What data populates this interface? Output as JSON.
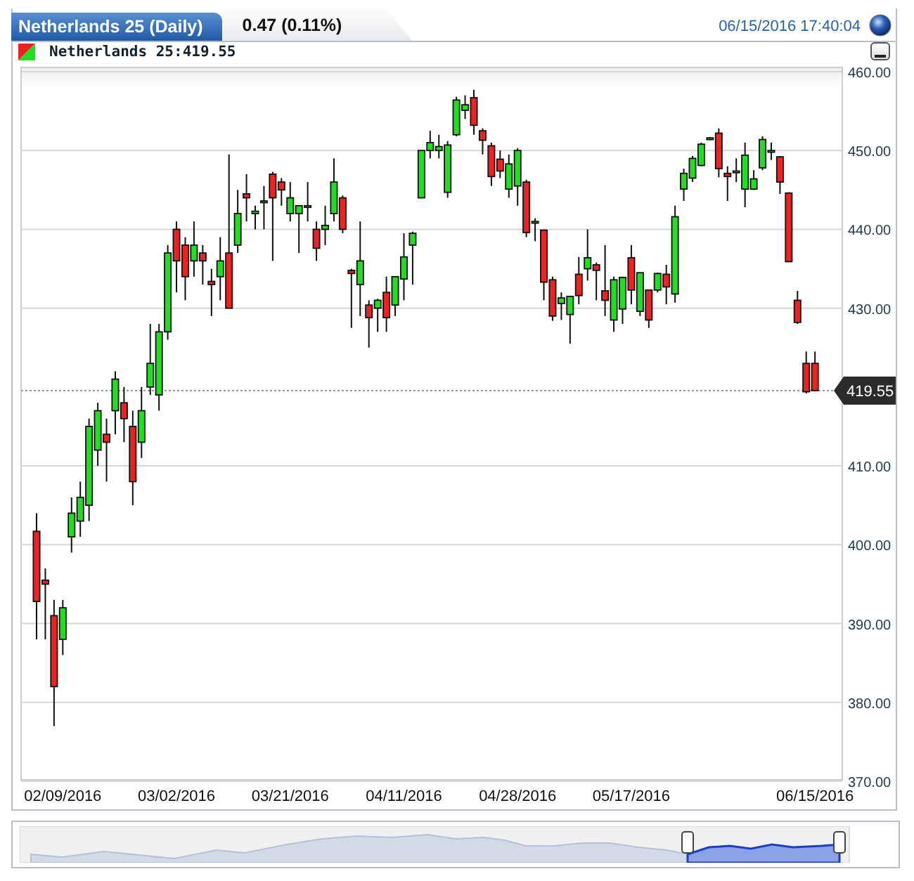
{
  "header": {
    "title": "Netherlands 25 (Daily)",
    "change": "0.47 (0.11%)",
    "timestamp": "06/15/2016 17:40:04"
  },
  "legend": {
    "label": "Netherlands 25:419.55"
  },
  "chart": {
    "chart_data": {
      "type": "candlestick",
      "ylim": [
        370,
        460
      ],
      "categories": [
        null,
        null,
        null,
        "02/09/2016",
        null,
        null,
        null,
        null,
        null,
        null,
        null,
        null,
        null,
        null,
        null,
        null,
        "03/02/2016",
        null,
        null,
        null,
        null,
        null,
        null,
        null,
        null,
        null,
        null,
        null,
        null,
        "03/21/2016",
        null,
        null,
        null,
        null,
        null,
        null,
        null,
        null,
        null,
        null,
        null,
        null,
        "04/11/2016",
        null,
        null,
        null,
        null,
        null,
        null,
        null,
        null,
        null,
        null,
        null,
        null,
        "04/28/2016",
        null,
        null,
        null,
        null,
        null,
        null,
        null,
        null,
        null,
        null,
        null,
        null,
        "05/17/2016",
        null,
        null,
        null,
        null,
        null,
        null,
        null,
        null,
        null,
        null,
        null,
        null,
        null,
        null,
        null,
        null,
        null,
        null,
        null,
        null,
        "06/15/2016"
      ],
      "yticks": [
        {
          "value": 370,
          "label": "370.00"
        },
        {
          "value": 380,
          "label": "380.00"
        },
        {
          "value": 390,
          "label": "390.00"
        },
        {
          "value": 400,
          "label": "400.00"
        },
        {
          "value": 410,
          "label": "410.00"
        },
        {
          "value": 430,
          "label": "430.00"
        },
        {
          "value": 440,
          "label": "440.00"
        },
        {
          "value": 450,
          "label": "450.00"
        },
        {
          "value": 460,
          "label": "460.00"
        }
      ],
      "ohlc": [
        [
          401.7,
          404,
          388,
          392.8
        ],
        [
          395.5,
          397,
          388,
          395
        ],
        [
          391,
          393,
          377,
          382
        ],
        [
          388,
          393,
          386,
          392
        ],
        [
          401,
          406,
          399,
          404
        ],
        [
          403,
          408,
          401,
          406
        ],
        [
          405,
          416,
          403,
          415
        ],
        [
          412,
          418,
          410,
          417
        ],
        [
          414,
          416,
          408,
          413
        ],
        [
          417,
          422,
          414,
          421
        ],
        [
          418,
          420,
          413,
          416
        ],
        [
          415,
          417,
          405,
          408
        ],
        [
          413,
          420,
          411,
          417
        ],
        [
          420,
          428,
          419,
          423
        ],
        [
          419,
          428,
          417,
          427
        ],
        [
          427,
          438,
          426,
          437
        ],
        [
          440,
          441,
          432,
          436
        ],
        [
          438,
          439,
          431,
          434
        ],
        [
          436,
          441,
          434,
          438
        ],
        [
          437,
          438,
          433,
          436
        ],
        [
          433.4,
          435,
          429,
          433
        ],
        [
          434,
          439,
          431,
          436
        ],
        [
          437,
          449.5,
          430,
          430
        ],
        [
          438,
          445,
          437,
          442
        ],
        [
          444.5,
          447,
          441,
          444
        ],
        [
          442,
          443,
          440,
          442.3
        ],
        [
          443.6,
          445.5,
          440,
          443.6
        ],
        [
          447,
          447.3,
          436,
          444
        ],
        [
          446,
          446.5,
          443,
          445
        ],
        [
          442,
          446,
          441,
          444
        ],
        [
          442,
          443,
          437,
          443
        ],
        [
          443,
          446,
          441,
          443
        ],
        [
          440,
          441,
          436,
          437.6
        ],
        [
          440,
          443,
          438,
          440.5
        ],
        [
          442,
          449,
          441,
          446
        ],
        [
          444,
          444.3,
          439.5,
          440
        ],
        [
          434.8,
          435,
          427.5,
          434.4
        ],
        [
          433,
          441,
          429,
          436
        ],
        [
          430.4,
          431,
          425,
          428.8
        ],
        [
          430,
          431.2,
          427,
          431
        ],
        [
          432,
          434,
          427,
          428.8
        ],
        [
          430.4,
          434,
          429,
          434
        ],
        [
          433.7,
          439.5,
          431,
          436.5
        ],
        [
          438,
          439.7,
          433,
          439.5
        ],
        [
          444,
          450,
          444,
          450
        ],
        [
          450,
          452.5,
          449,
          451
        ],
        [
          450,
          452,
          449,
          450.5
        ],
        [
          444.7,
          451.2,
          444,
          450.7
        ],
        [
          452,
          456.8,
          451.8,
          456.4
        ],
        [
          455.1,
          457,
          454,
          455.8
        ],
        [
          456.7,
          457.7,
          452,
          453.2
        ],
        [
          452.5,
          452.8,
          449.5,
          451.3
        ],
        [
          450.6,
          451,
          445.5,
          446.7
        ],
        [
          448.9,
          450,
          446.5,
          447.4
        ],
        [
          445.1,
          449.5,
          444,
          448.3
        ],
        [
          445.5,
          450.3,
          443,
          450
        ],
        [
          446,
          446.3,
          439,
          439.6
        ],
        [
          441,
          441.4,
          438.5,
          441
        ],
        [
          439.9,
          439.9,
          431,
          433.3
        ],
        [
          433.6,
          434,
          428.4,
          429
        ],
        [
          430.6,
          432,
          428.5,
          431.3
        ],
        [
          429.2,
          431.5,
          425.5,
          431.5
        ],
        [
          434.3,
          436.5,
          430.5,
          431.6
        ],
        [
          435,
          440,
          433.5,
          436.4
        ],
        [
          435.5,
          435.8,
          431,
          434.8
        ],
        [
          432.2,
          438,
          429,
          431
        ],
        [
          428.5,
          434,
          427,
          433.6
        ],
        [
          429.9,
          434,
          428,
          433.9
        ],
        [
          436.4,
          438,
          430.5,
          432.3
        ],
        [
          429.6,
          434.5,
          429,
          434.5
        ],
        [
          432.3,
          432.3,
          427.5,
          428.5
        ],
        [
          432.3,
          434.5,
          432,
          434.4
        ],
        [
          434.3,
          435.5,
          430.5,
          432.7
        ],
        [
          431.8,
          443,
          430.7,
          441.6
        ],
        [
          445.1,
          447.7,
          443.6,
          447.1
        ],
        [
          446.5,
          449.3,
          446,
          449
        ],
        [
          448.1,
          451,
          448,
          450.8
        ],
        [
          451.6,
          451.7,
          451.3,
          451.6
        ],
        [
          452.2,
          452.8,
          446.6,
          447.7
        ],
        [
          447.1,
          448,
          443.6,
          446.7
        ],
        [
          447.4,
          449,
          446,
          447.4
        ],
        [
          445.1,
          451,
          442.8,
          449.4
        ],
        [
          445.1,
          447.5,
          445,
          446.4
        ],
        [
          447.8,
          451.8,
          447.5,
          451.4
        ],
        [
          450,
          451,
          448.8,
          450
        ],
        [
          449.2,
          449.3,
          444.5,
          446
        ],
        [
          444.6,
          444.7,
          435.9,
          435.9
        ],
        [
          431,
          432.2,
          428,
          428.2
        ],
        [
          423,
          424.5,
          419.2,
          419.4
        ],
        [
          423,
          424.5,
          419.5,
          419.55
        ]
      ],
      "grid": true,
      "ref_lines": [
        {
          "axis": "y",
          "value": 419.55,
          "label": "419.55"
        }
      ]
    }
  }
}
